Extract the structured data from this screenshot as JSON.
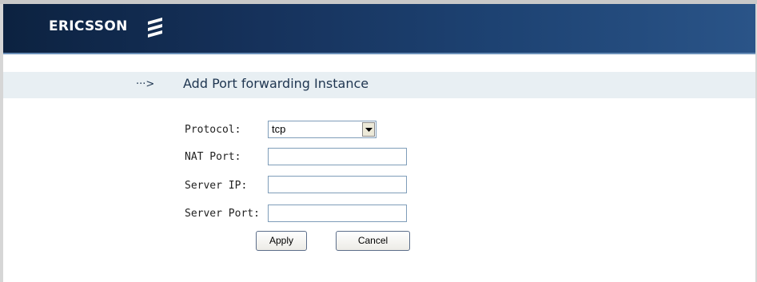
{
  "header": {
    "brand": "ERICSSON",
    "logo_icon": "ericsson-logo-icon",
    "background": "#16325c"
  },
  "page": {
    "arrow": "···>",
    "title": "Add Port forwarding Instance"
  },
  "form": {
    "protocol_label": "Protocol:",
    "protocol_value": "tcp",
    "nat_port_label": "NAT Port:",
    "nat_port_value": "",
    "server_ip_label": "Server IP:",
    "server_ip_value": "",
    "server_port_label": "Server Port:",
    "server_port_value": ""
  },
  "buttons": {
    "apply": "Apply",
    "cancel": "Cancel"
  }
}
